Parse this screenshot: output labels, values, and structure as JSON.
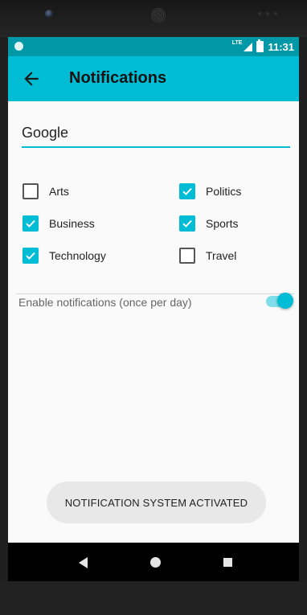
{
  "status_bar": {
    "network": "LTE",
    "time": "11:31"
  },
  "app_bar": {
    "title": "Notifications",
    "back_icon": "arrow-back-icon"
  },
  "query": {
    "value": "Google"
  },
  "categories": [
    {
      "label": "Arts",
      "checked": false
    },
    {
      "label": "Politics",
      "checked": true
    },
    {
      "label": "Business",
      "checked": true
    },
    {
      "label": "Sports",
      "checked": true
    },
    {
      "label": "Technology",
      "checked": true
    },
    {
      "label": "Travel",
      "checked": false
    }
  ],
  "notifications": {
    "label": "Enable notifications (once per day)",
    "enabled": true
  },
  "toast": {
    "text": "NOTIFICATION SYSTEM ACTIVATED"
  },
  "colors": {
    "accent": "#00bcd4",
    "status_bar": "#0097a7"
  }
}
